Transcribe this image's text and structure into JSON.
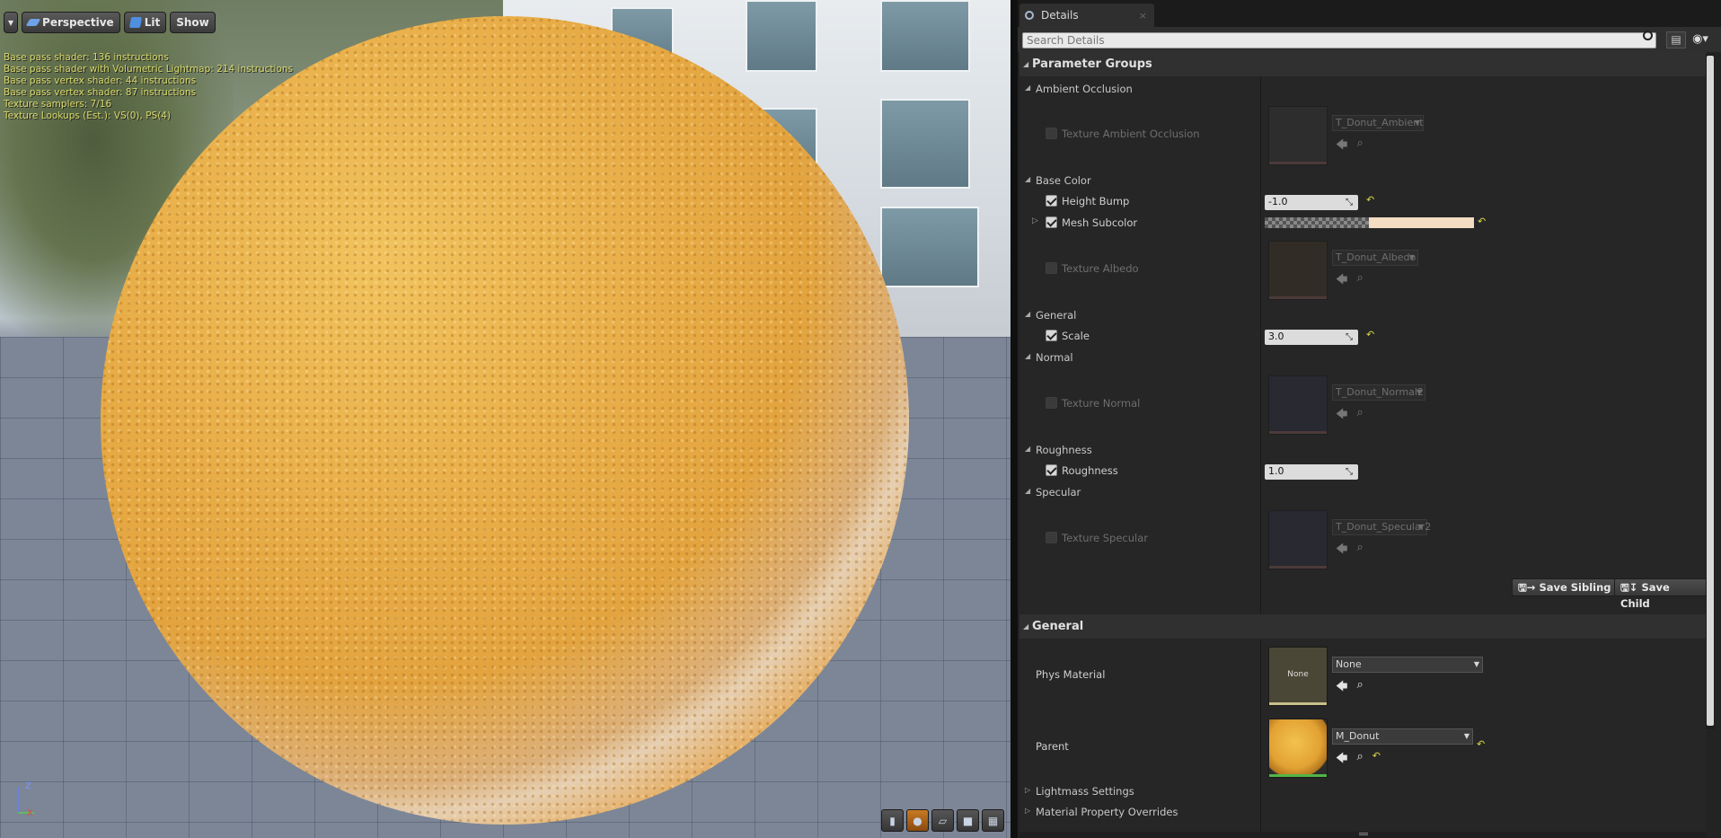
{
  "viewport": {
    "toolbar": {
      "menu_arrow": "▾",
      "perspective_label": "Perspective",
      "lit_label": "Lit",
      "show_label": "Show"
    },
    "stats": [
      "Base pass shader: 136 instructions",
      "Base pass shader with Volumetric Lightmap: 214 instructions",
      "Base pass vertex shader: 44 instructions",
      "Base pass vertex shader: 87 instructions",
      "Texture samplers: 7/16",
      "Texture Lookups (Est.): VS(0), PS(4)"
    ],
    "axis": {
      "z": "Z",
      "x": "X"
    }
  },
  "details": {
    "tab_title": "Details",
    "tab_close": "×",
    "search_placeholder": "Search Details",
    "parameter_groups_title": "Parameter Groups",
    "groups": {
      "ambient_occlusion": {
        "title": "Ambient Occlusion",
        "texture_label": "Texture Ambient Occlusion",
        "texture_value": "T_Donut_Ambient"
      },
      "base_color": {
        "title": "Base Color",
        "height_bump_label": "Height Bump",
        "height_bump_value": "-1.0",
        "mesh_subcolor_label": "Mesh Subcolor",
        "mesh_subcolor_color": "#f3dcc1",
        "texture_label": "Texture Albedo",
        "texture_value": "T_Donut_Albedo"
      },
      "general": {
        "title": "General",
        "scale_label": "Scale",
        "scale_value": "3.0"
      },
      "normal": {
        "title": "Normal",
        "texture_label": "Texture Normal",
        "texture_value": "T_Donut_Normal2"
      },
      "roughness": {
        "title": "Roughness",
        "roughness_label": "Roughness",
        "roughness_value": "1.0"
      },
      "specular": {
        "title": "Specular",
        "texture_label": "Texture Specular",
        "texture_value": "T_Donut_Specular2"
      }
    },
    "save_sibling_label": "Save Sibling",
    "save_child_label": "Save Child",
    "general_section_title": "General",
    "phys_material_label": "Phys Material",
    "phys_material_thumb": "None",
    "phys_material_value": "None",
    "parent_label": "Parent",
    "parent_value": "M_Donut",
    "lightmass_label": "Lightmass Settings",
    "overrides_label": "Material Property Overrides"
  },
  "colors": {
    "stats_text": "#d9d96a",
    "reset_arrow": "#d8d84a",
    "panel_bg": "#232323",
    "accent_active": "#c87a23"
  }
}
